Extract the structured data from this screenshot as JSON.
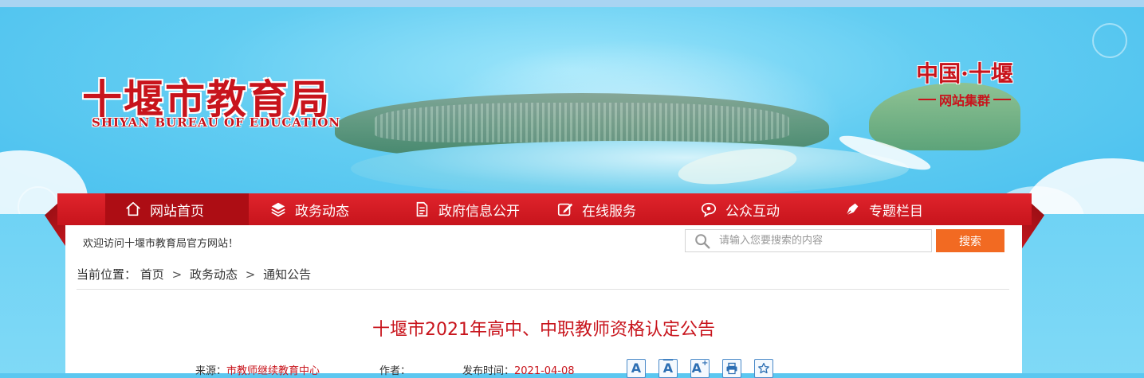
{
  "header": {
    "site_title": "十堰市教育局",
    "site_subtitle": "SHIYAN BUREAU OF EDUCATION",
    "group_title": "中国·十堰",
    "group_sub": "网站集群"
  },
  "nav": {
    "items": [
      {
        "label": "网站首页",
        "icon": "home-icon"
      },
      {
        "label": "政务动态",
        "icon": "layers-icon"
      },
      {
        "label": "政府信息公开",
        "icon": "document-icon"
      },
      {
        "label": "在线服务",
        "icon": "edit-icon"
      },
      {
        "label": "公众互动",
        "icon": "chat-icon"
      },
      {
        "label": "专题栏目",
        "icon": "pen-icon"
      }
    ],
    "active_index": 0
  },
  "toolbar": {
    "welcome": "欢迎访问十堰市教育局官方网站！",
    "search_placeholder": "请输入您要搜索的内容",
    "search_button": "搜索"
  },
  "breadcrumb": {
    "prefix": "当前位置：",
    "items": [
      "首页",
      "政务动态",
      "通知公告"
    ],
    "separator": ">"
  },
  "article": {
    "title": "十堰市2021年高中、中职教师资格认定公告",
    "source_label": "来源：",
    "source_value": "市教师继续教育中心",
    "author_label": "作者：",
    "author_value": "",
    "date_label": "发布时间：",
    "date_value": "2021-04-08"
  },
  "tools": [
    {
      "name": "font-normal-button",
      "glyph": "A"
    },
    {
      "name": "font-decrease-button",
      "glyph": "A"
    },
    {
      "name": "font-increase-button",
      "glyph": "A"
    },
    {
      "name": "print-button",
      "glyph": "print-icon"
    },
    {
      "name": "favorite-button",
      "glyph": "star-icon"
    }
  ],
  "colors": {
    "brand_red": "#c8141c",
    "nav_active": "#ad0d14",
    "search_button": "#f26a22",
    "tool_blue": "#2d6fb3"
  }
}
